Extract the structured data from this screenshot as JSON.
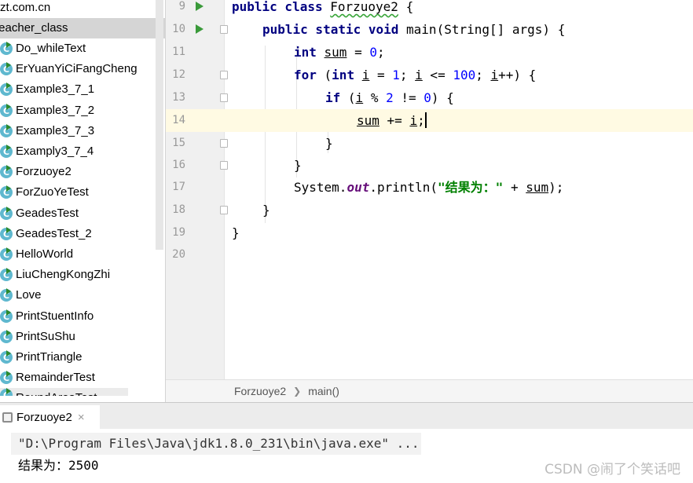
{
  "project": {
    "top_path": "zt.com.cn",
    "package": "teacher_class",
    "classes": [
      "Do_whileText",
      "ErYuanYiCiFangCheng",
      "Example3_7_1",
      "Example3_7_2",
      "Example3_7_3",
      "Examply3_7_4",
      "Forzuoye2",
      "ForZuoYeTest",
      "GeadesTest",
      "GeadesTest_2",
      "HelloWorld",
      "LiuChengKongZhi",
      "Love",
      "PrintStuentInfo",
      "PrintSuShu",
      "PrintTriangle",
      "RemainderTest",
      "RoundAreaTest"
    ],
    "class_icon_letter": "C"
  },
  "editor": {
    "lines": [
      {
        "n": "9"
      },
      {
        "n": "10"
      },
      {
        "n": "11"
      },
      {
        "n": "12"
      },
      {
        "n": "13"
      },
      {
        "n": "14"
      },
      {
        "n": "15"
      },
      {
        "n": "16"
      },
      {
        "n": "17"
      },
      {
        "n": "18"
      },
      {
        "n": "19"
      },
      {
        "n": "20"
      }
    ],
    "code": {
      "l9_kw": "public class ",
      "l9_name": "Forzuoye2",
      "l9_rest": " {",
      "l10_kw": "public static void ",
      "l10_rest": "main(String[] args) {",
      "l11_kw": "int ",
      "l11_var": "sum",
      "l11_mid": " = ",
      "l11_num": "0",
      "l11_end": ";",
      "l12_kw": "for ",
      "l12_a": "(",
      "l12_kw2": "int ",
      "l12_v1": "i",
      "l12_b": " = ",
      "l12_n1": "1",
      "l12_c": "; ",
      "l12_v2": "i",
      "l12_d": " <= ",
      "l12_n2": "100",
      "l12_e": "; ",
      "l12_v3": "i",
      "l12_f": "++) {",
      "l13_kw": "if ",
      "l13_a": "(",
      "l13_v": "i",
      "l13_b": " % ",
      "l13_n1": "2",
      "l13_c": " != ",
      "l13_n2": "0",
      "l13_d": ") {",
      "l14_v1": "sum",
      "l14_a": " += ",
      "l14_v2": "i",
      "l14_b": ";",
      "l15": "}",
      "l16": "}",
      "l17_a": "System.",
      "l17_fld": "out",
      "l17_b": ".println(",
      "l17_str": "\"结果为：\"",
      "l17_c": " + ",
      "l17_v": "sum",
      "l17_d": ");",
      "l18": "}",
      "l19": "}"
    },
    "breadcrumb": [
      "Forzuoye2",
      "main()"
    ]
  },
  "run": {
    "tab_label": "Forzuoye2",
    "tab_close": "×",
    "command": "\"D:\\Program Files\\Java\\jdk1.8.0_231\\bin\\java.exe\" ...",
    "output": "结果为：2500"
  },
  "watermark": "CSDN @闹了个笑话吧",
  "colors": {
    "keyword": "#000080",
    "number": "#0000ff",
    "string": "#008000",
    "field": "#660e7a",
    "current_line": "#fffae3",
    "selected_package": "#d5d5d5"
  }
}
